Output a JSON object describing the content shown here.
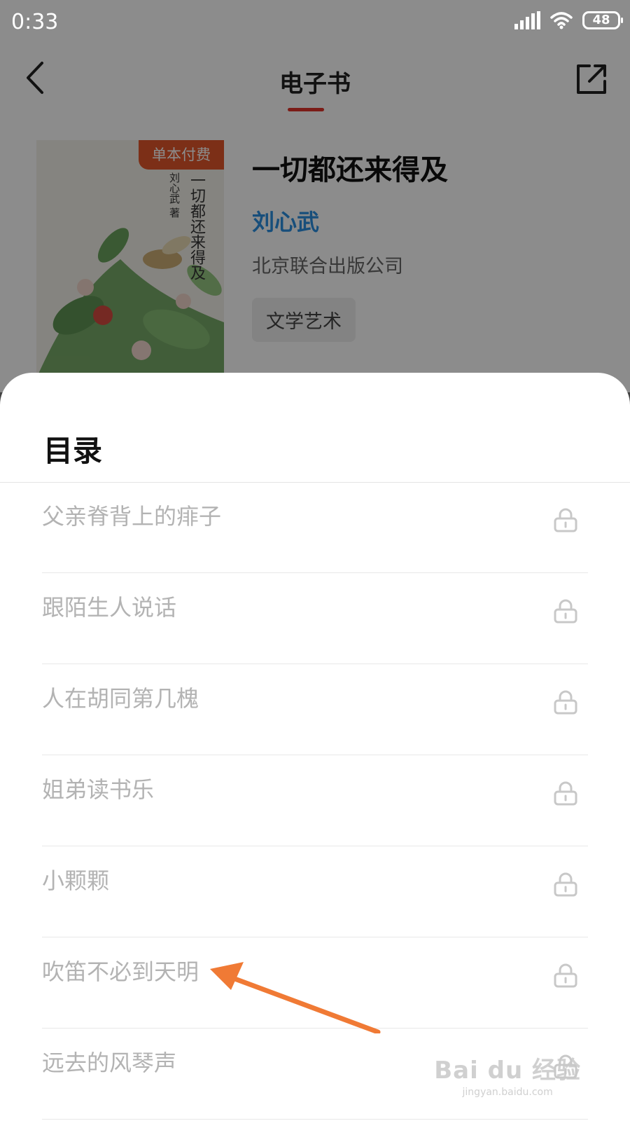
{
  "status_bar": {
    "time": "0:33",
    "battery": "48"
  },
  "nav": {
    "title": "电子书"
  },
  "book": {
    "badge": "单本付费",
    "cover_title": "一切都还来得及",
    "cover_author": "刘心武 著",
    "title": "一切都还来得及",
    "author": "刘心武",
    "publisher": "北京联合出版公司",
    "tag": "文学艺术"
  },
  "toc": {
    "title": "目录",
    "items": [
      {
        "label": "父亲脊背上的痱子",
        "locked": true
      },
      {
        "label": "跟陌生人说话",
        "locked": true
      },
      {
        "label": "人在胡同第几槐",
        "locked": true
      },
      {
        "label": "姐弟读书乐",
        "locked": true
      },
      {
        "label": "小颗颗",
        "locked": true
      },
      {
        "label": "吹笛不必到天明",
        "locked": true
      },
      {
        "label": "远去的风琴声",
        "locked": true
      }
    ]
  },
  "colors": {
    "accent_red": "#e0342a",
    "author_blue": "#2a8fe0",
    "badge_orange": "#e2572a",
    "annotation_arrow": "#f07a35"
  },
  "watermark": {
    "logo": "Bai du 经验",
    "url": "jingyan.baidu.com"
  }
}
